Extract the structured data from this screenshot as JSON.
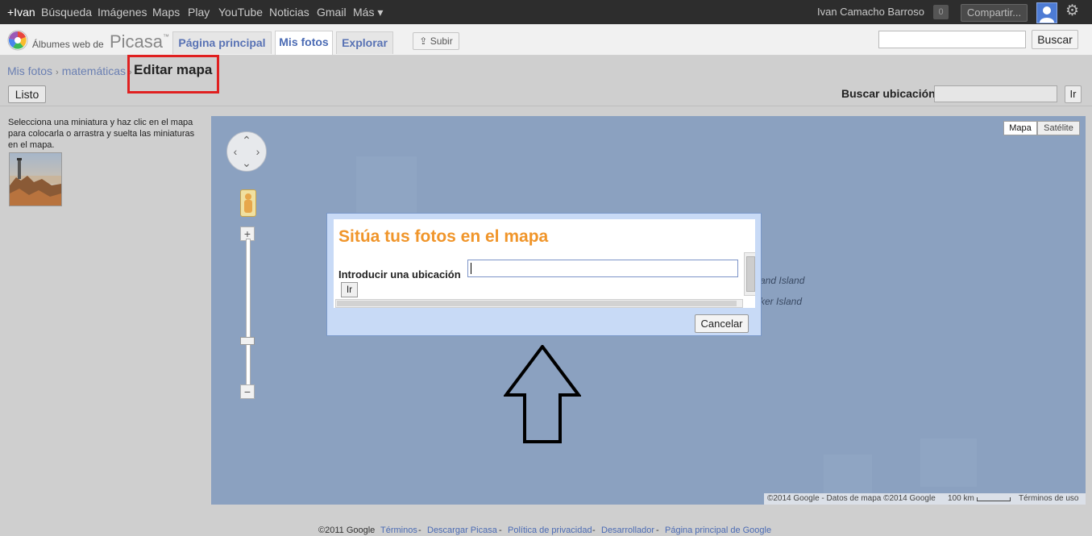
{
  "gbar": {
    "links": [
      "+Ivan",
      "Búsqueda",
      "Imágenes",
      "Maps",
      "Play",
      "YouTube",
      "Noticias",
      "Gmail",
      "Más ▾"
    ],
    "user_name": "Ivan Camacho Barroso",
    "notifications": "0",
    "share_label": "Compartir..."
  },
  "header": {
    "logo_text": "Álbumes web de",
    "logo_brand": "Picasa",
    "logo_tm": "™",
    "tabs": [
      "Página principal",
      "Mis fotos",
      "Explorar"
    ],
    "upload_label": "Subir",
    "search_label": "Buscar"
  },
  "breadcrumb": {
    "items": [
      "Mis fotos",
      "matemáticas"
    ],
    "separator": "›",
    "title": "Editar mapa"
  },
  "controls": {
    "done_label": "Listo",
    "search_location_label": "Buscar ubicación",
    "go_label": "Ir"
  },
  "left_panel": {
    "instructions": "Selecciona una miniatura y haz clic en el mapa para colocarla o arrastra y suelta las miniaturas en el mapa."
  },
  "map": {
    "type_buttons": [
      "Mapa",
      "Satélite"
    ],
    "labels": [
      "and Island",
      "ker Island"
    ],
    "zoom_in": "+",
    "zoom_out": "−",
    "attribution": {
      "data": "©2014 Google - Datos de mapa ©2014 Google",
      "scale": "100 km",
      "terms": "Términos de uso"
    }
  },
  "dialog": {
    "title": "Sitúa tus fotos en el mapa",
    "location_label": "Introducir una ubicación",
    "location_value": "",
    "go_label": "Ir",
    "cancel_label": "Cancelar"
  },
  "footer": {
    "copyright": "©2011 Google",
    "links": [
      "Términos",
      "Descargar Picasa",
      "Política de privacidad",
      "Desarrollador",
      "Página principal de Google"
    ],
    "separator": "-"
  },
  "colors": {
    "gbar_bg": "#2d2d2d",
    "map_water": "#8ba1c0",
    "dialog_title": "#f0952a",
    "link": "#4b6bb4",
    "annotation_box": "#e02020"
  }
}
